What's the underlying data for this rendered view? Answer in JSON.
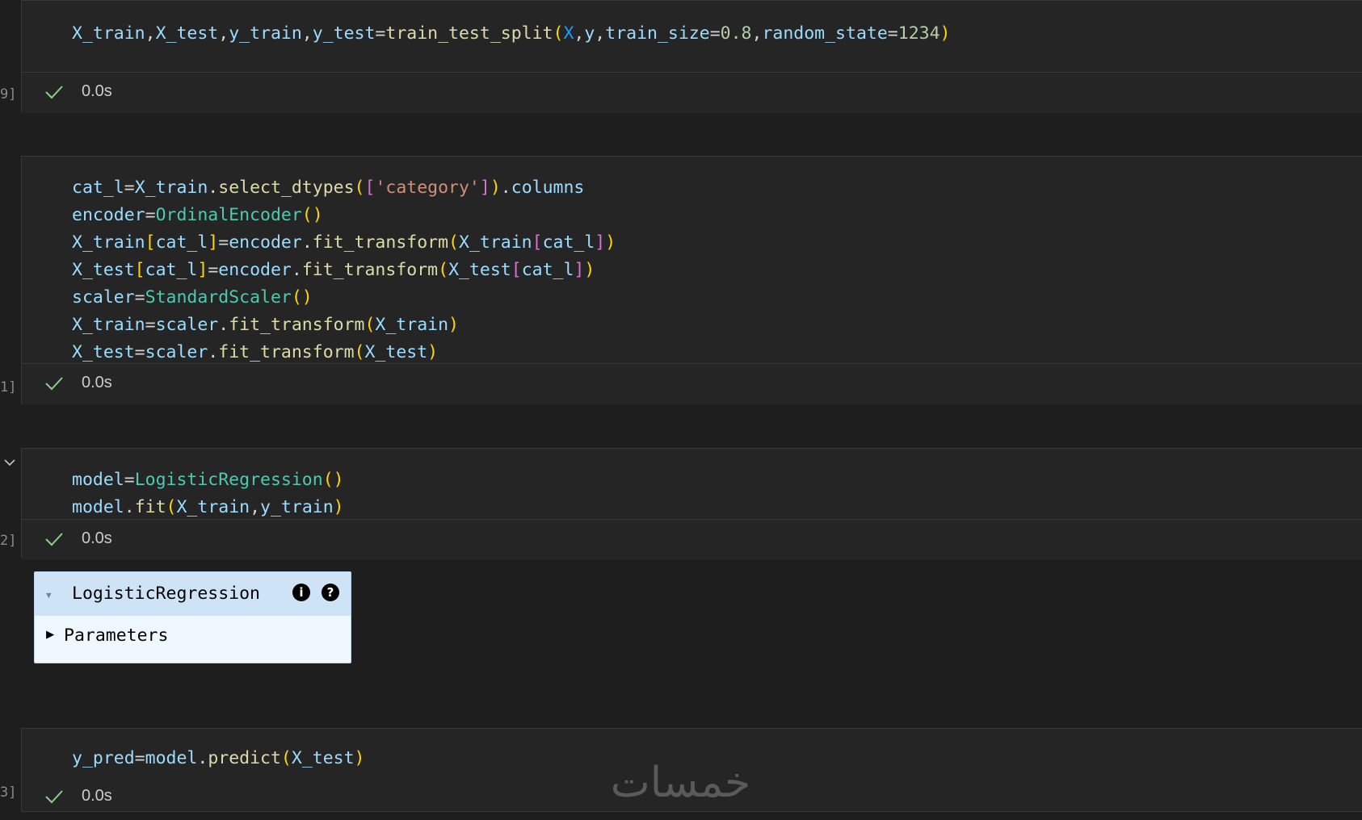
{
  "cells": [
    {
      "exec_label": "9]",
      "status_time": "0.0s",
      "code": [
        [
          [
            "X_train",
            "v"
          ],
          [
            ",",
            "o"
          ],
          [
            "X_test",
            "v"
          ],
          [
            ",",
            "o"
          ],
          [
            "y_train",
            "v"
          ],
          [
            ",",
            "o"
          ],
          [
            "y_test",
            "v"
          ],
          [
            "=",
            "o"
          ],
          [
            "train_test_split",
            "f"
          ],
          [
            "(",
            "p1"
          ],
          [
            "X",
            "p3"
          ],
          [
            ",",
            "o"
          ],
          [
            "y",
            "v"
          ],
          [
            ",",
            "o"
          ],
          [
            "train_size",
            "v"
          ],
          [
            "=",
            "o"
          ],
          [
            "0.8",
            "n"
          ],
          [
            ",",
            "o"
          ],
          [
            "random_state",
            "v"
          ],
          [
            "=",
            "o"
          ],
          [
            "1234",
            "n"
          ],
          [
            ")",
            "p1"
          ]
        ]
      ]
    },
    {
      "exec_label": "1]",
      "status_time": "0.0s",
      "code": [
        [
          [
            "cat_l",
            "v"
          ],
          [
            "=",
            "o"
          ],
          [
            "X_train",
            "v"
          ],
          [
            ".",
            "o"
          ],
          [
            "select_dtypes",
            "f"
          ],
          [
            "(",
            "p1"
          ],
          [
            "[",
            "p2"
          ],
          [
            "'category'",
            "s"
          ],
          [
            "]",
            "p2"
          ],
          [
            ")",
            "p1"
          ],
          [
            ".",
            "o"
          ],
          [
            "columns",
            "v"
          ]
        ],
        [
          [
            "encoder",
            "v"
          ],
          [
            "=",
            "o"
          ],
          [
            "OrdinalEncoder",
            "c"
          ],
          [
            "()",
            "p1"
          ]
        ],
        [
          [
            "X_train",
            "v"
          ],
          [
            "[",
            "p1"
          ],
          [
            "cat_l",
            "v"
          ],
          [
            "]",
            "p1"
          ],
          [
            "=",
            "o"
          ],
          [
            "encoder",
            "v"
          ],
          [
            ".",
            "o"
          ],
          [
            "fit_transform",
            "f"
          ],
          [
            "(",
            "p1"
          ],
          [
            "X_train",
            "v"
          ],
          [
            "[",
            "p2"
          ],
          [
            "cat_l",
            "v"
          ],
          [
            "]",
            "p2"
          ],
          [
            ")",
            "p1"
          ]
        ],
        [
          [
            "X_test",
            "v"
          ],
          [
            "[",
            "p1"
          ],
          [
            "cat_l",
            "v"
          ],
          [
            "]",
            "p1"
          ],
          [
            "=",
            "o"
          ],
          [
            "encoder",
            "v"
          ],
          [
            ".",
            "o"
          ],
          [
            "fit_transform",
            "f"
          ],
          [
            "(",
            "p1"
          ],
          [
            "X_test",
            "v"
          ],
          [
            "[",
            "p2"
          ],
          [
            "cat_l",
            "v"
          ],
          [
            "]",
            "p2"
          ],
          [
            ")",
            "p1"
          ]
        ],
        [
          [
            "scaler",
            "v"
          ],
          [
            "=",
            "o"
          ],
          [
            "StandardScaler",
            "c"
          ],
          [
            "()",
            "p1"
          ]
        ],
        [
          [
            "X_train",
            "v"
          ],
          [
            "=",
            "o"
          ],
          [
            "scaler",
            "v"
          ],
          [
            ".",
            "o"
          ],
          [
            "fit_transform",
            "f"
          ],
          [
            "(",
            "p1"
          ],
          [
            "X_train",
            "v"
          ],
          [
            ")",
            "p1"
          ]
        ],
        [
          [
            "X_test",
            "v"
          ],
          [
            "=",
            "o"
          ],
          [
            "scaler",
            "v"
          ],
          [
            ".",
            "o"
          ],
          [
            "fit_transform",
            "f"
          ],
          [
            "(",
            "p1"
          ],
          [
            "X_test",
            "v"
          ],
          [
            ")",
            "p1"
          ]
        ]
      ]
    },
    {
      "exec_label": "2]",
      "status_time": "0.0s",
      "code": [
        [
          [
            "model",
            "v"
          ],
          [
            "=",
            "o"
          ],
          [
            "LogisticRegression",
            "c"
          ],
          [
            "()",
            "p1"
          ]
        ],
        [
          [
            "model",
            "v"
          ],
          [
            ".",
            "o"
          ],
          [
            "fit",
            "f"
          ],
          [
            "(",
            "p1"
          ],
          [
            "X_train",
            "v"
          ],
          [
            ",",
            "o"
          ],
          [
            "y_train",
            "v"
          ],
          [
            ")",
            "p1"
          ]
        ]
      ]
    },
    {
      "exec_label": "3]",
      "status_time": "0.0s",
      "code": [
        [
          [
            "y_pred",
            "v"
          ],
          [
            "=",
            "o"
          ],
          [
            "model",
            "v"
          ],
          [
            ".",
            "o"
          ],
          [
            "predict",
            "f"
          ],
          [
            "(",
            "p1"
          ],
          [
            "X_test",
            "v"
          ],
          [
            ")",
            "p1"
          ]
        ]
      ]
    }
  ],
  "estimator": {
    "name": "LogisticRegression",
    "info_icon": "i",
    "help_icon": "?",
    "params_label": "Parameters"
  },
  "watermark": "خمسات",
  "colors": {
    "background": "#1e1e1e",
    "cell": "#252526",
    "check": "#89d185"
  }
}
